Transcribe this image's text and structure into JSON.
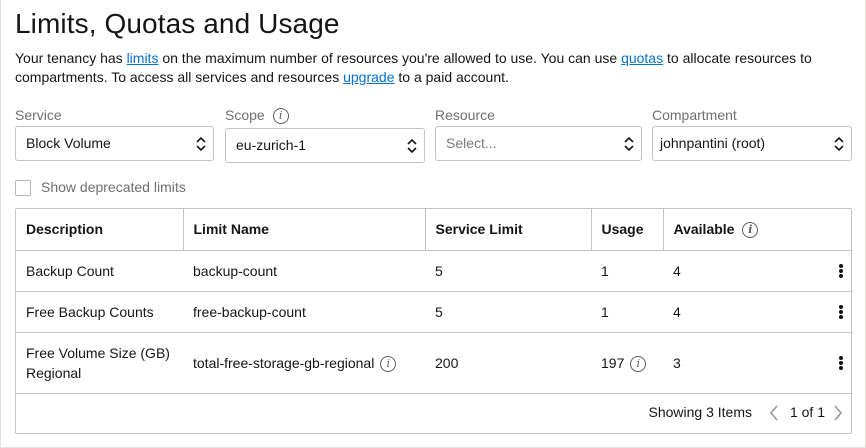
{
  "page": {
    "title": "Limits, Quotas and Usage",
    "intro": {
      "part1": "Your tenancy has ",
      "link_limits": "limits",
      "part2": " on the maximum number of resources you're allowed to use. You can use ",
      "link_quotas": "quotas",
      "part3": " to allocate resources to compartments. To access all services and resources ",
      "link_upgrade": "upgrade",
      "part4": " to a paid account."
    }
  },
  "filters": {
    "service": {
      "label": "Service",
      "value": "Block Volume"
    },
    "scope": {
      "label": "Scope",
      "value": "eu-zurich-1"
    },
    "resource": {
      "label": "Resource",
      "placeholder": "Select..."
    },
    "compartment": {
      "label": "Compartment",
      "value": "johnpantini (root)"
    }
  },
  "show_deprecated": {
    "label": "Show deprecated limits",
    "checked": false
  },
  "table": {
    "columns": {
      "description": "Description",
      "limit_name": "Limit Name",
      "service_limit": "Service Limit",
      "usage": "Usage",
      "available": "Available"
    },
    "rows": [
      {
        "description": "Backup Count",
        "limit_name": "backup-count",
        "service_limit": "5",
        "usage": "1",
        "available": "4"
      },
      {
        "description": "Free Backup Counts",
        "limit_name": "free-backup-count",
        "service_limit": "5",
        "usage": "1",
        "available": "4"
      },
      {
        "description": "Free Volume Size (GB) Regional",
        "limit_name": "total-free-storage-gb-regional",
        "service_limit": "200",
        "usage": "197",
        "available": "3"
      }
    ],
    "footer": {
      "showing": "Showing 3 Items",
      "pages": "1 of 1"
    }
  },
  "icons": {
    "info": "info-icon",
    "chevron": "chevron-up-down-icon",
    "kebab": "kebab-menu-icon",
    "prev": "chevron-left-icon",
    "next": "chevron-right-icon"
  },
  "colors": {
    "link": "#0572ce",
    "border": "#c5c3c0",
    "text": "#161513",
    "muted": "#6f6f6f"
  }
}
